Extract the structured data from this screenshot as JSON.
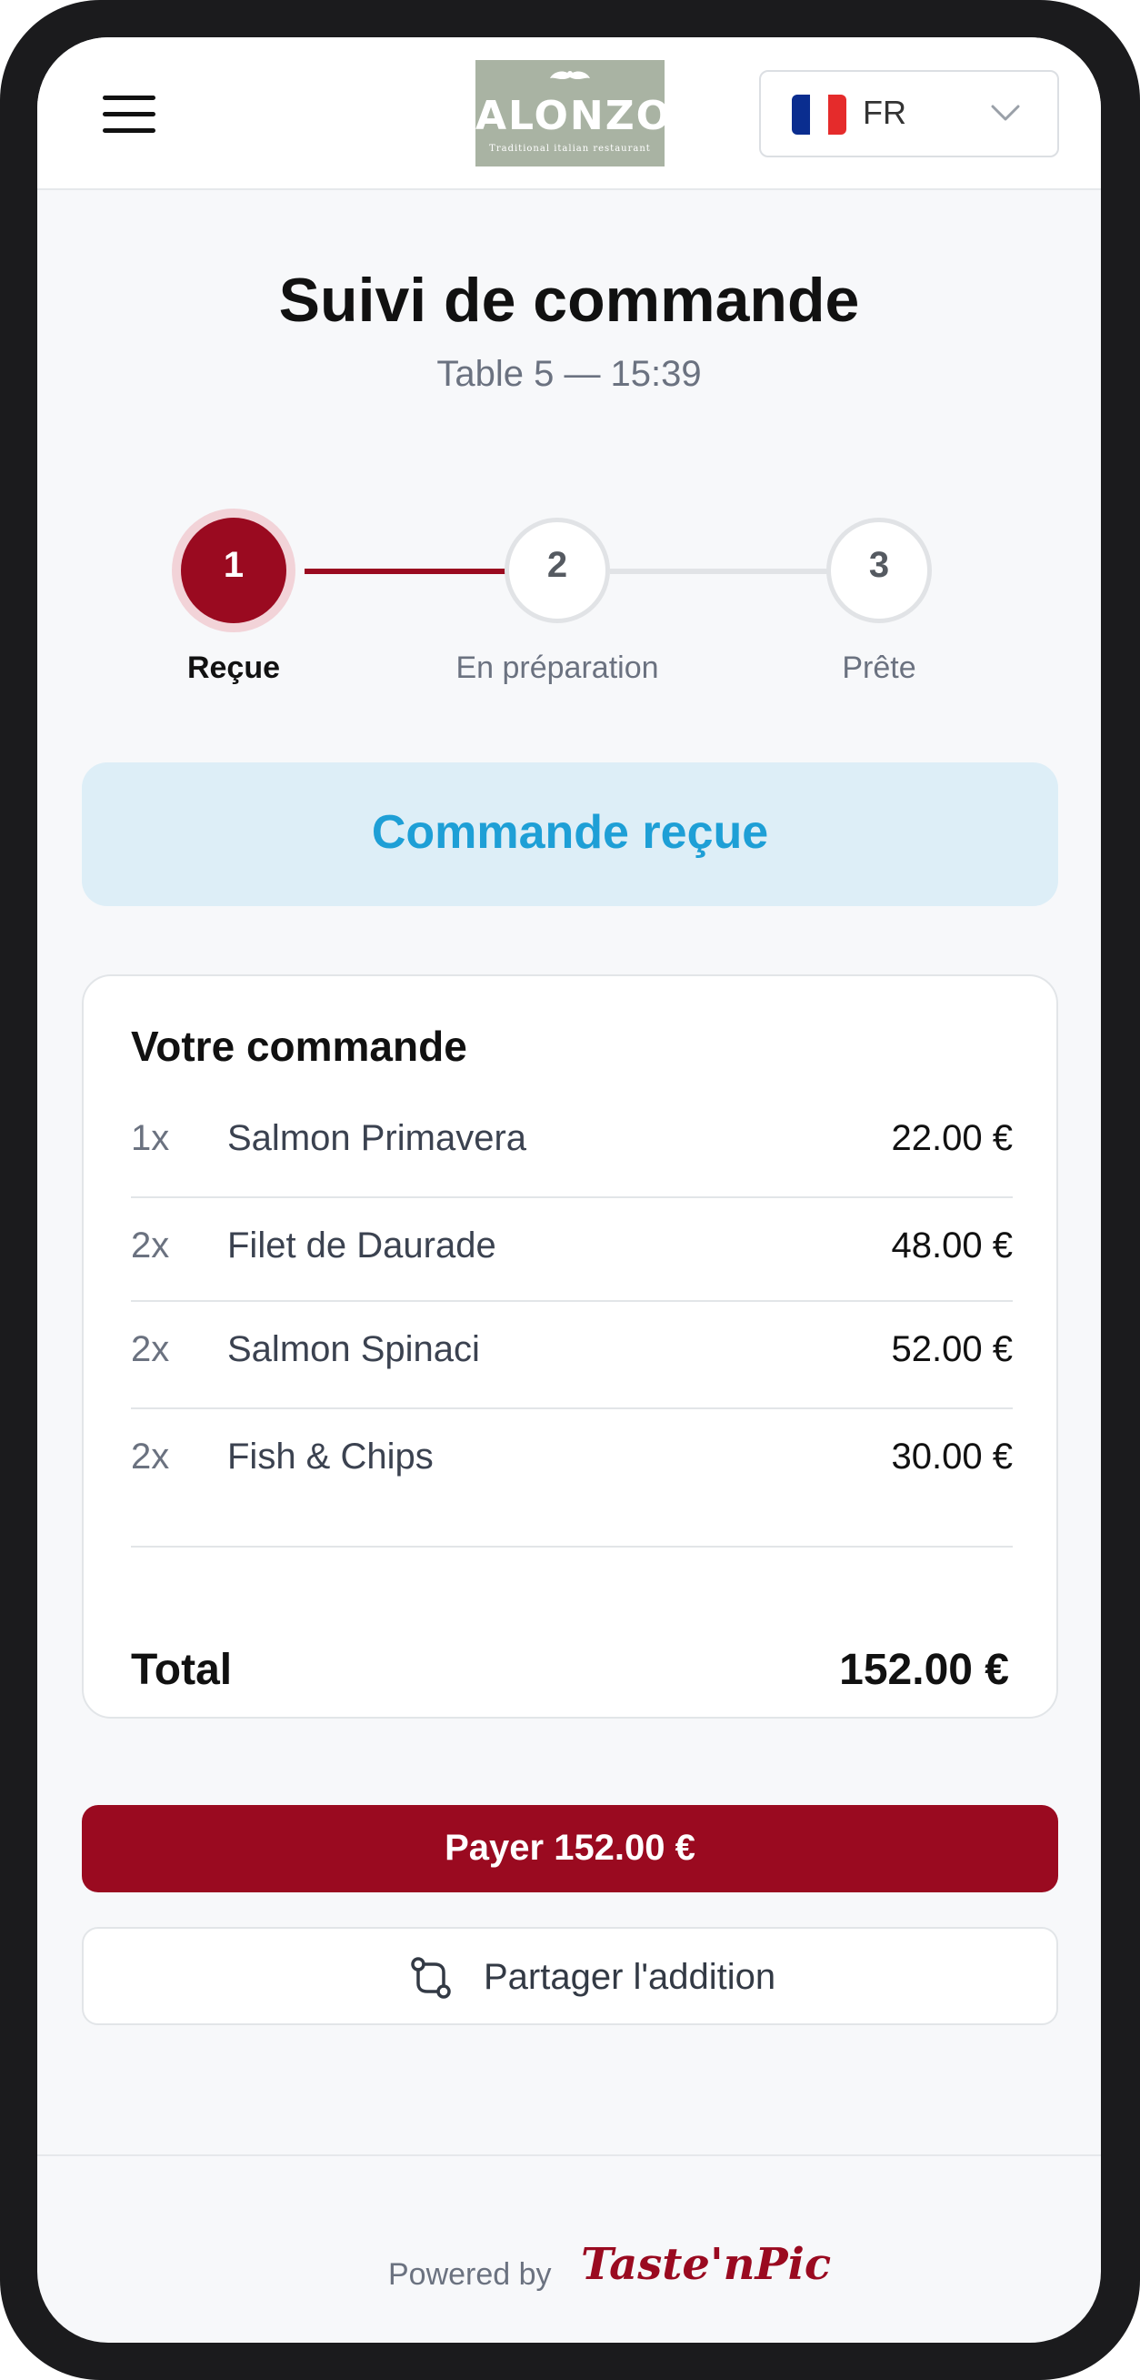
{
  "header": {
    "logo": {
      "name": "ALONZO",
      "tagline": "Traditional italian restaurant"
    },
    "language": {
      "code": "FR",
      "flag_colors": [
        "#0a2d8f",
        "#ffffff",
        "#e52b2b"
      ]
    }
  },
  "page": {
    "title": "Suivi de commande",
    "subtitle": "Table 5 — 15:39"
  },
  "stepper": {
    "current_step": 1,
    "steps": [
      {
        "number": "1",
        "label": "Reçue"
      },
      {
        "number": "2",
        "label": "En préparation"
      },
      {
        "number": "3",
        "label": "Prête"
      }
    ]
  },
  "status": {
    "text": "Commande reçue"
  },
  "order": {
    "title": "Votre commande",
    "items": [
      {
        "qty": "1x",
        "name": "Salmon Primavera",
        "price": "22.00 €"
      },
      {
        "qty": "2x",
        "name": "Filet de Daurade",
        "price": "48.00 €"
      },
      {
        "qty": "2x",
        "name": "Salmon Spinaci",
        "price": "52.00 €"
      },
      {
        "qty": "2x",
        "name": "Fish & Chips",
        "price": "30.00 €"
      }
    ],
    "total_label": "Total",
    "total_value": "152.00 €"
  },
  "actions": {
    "pay_label": "Payer 152.00 €",
    "share_label": "Partager l'addition",
    "share_icon": "split-bill-icon"
  },
  "footer": {
    "powered_by": "Powered by",
    "brand": "Taste'nPic"
  },
  "colors": {
    "accent": "#9a0a20",
    "status_text": "#1e9fd6",
    "status_bg": "#ddeef7"
  }
}
